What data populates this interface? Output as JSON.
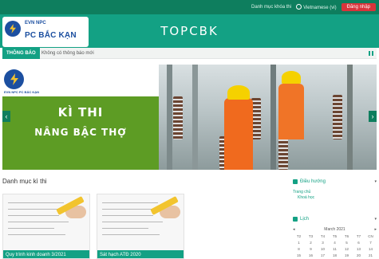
{
  "topbar": {
    "menu_label": "Danh mục khóa thi",
    "lang_label": "Vietnamese (vi)",
    "login_label": "Đăng nhập"
  },
  "header": {
    "logo_top": "EVN NPC",
    "logo_main": "PC BẮC KẠN",
    "site_title": "TOPCBK"
  },
  "notice": {
    "label": "THÔNG BÁO",
    "text": "Không có thông báo mới"
  },
  "banner": {
    "evn_text": "EVN NPC PC BẮC KẠN",
    "headline_1": "KÌ THI",
    "headline_2": "NÂNG BẬC THỢ"
  },
  "courses": {
    "section_title": "Danh mục kì thi",
    "items": [
      {
        "caption": "Quy trình kinh doanh 3/2021"
      },
      {
        "caption": "Sát hạch ATĐ 2020"
      }
    ]
  },
  "sidebar": {
    "nav_title": "Điều hướng",
    "home_label": "Trang chủ",
    "sub_label": "Khoá học",
    "calendar_title": "Lịch",
    "month_label": "March 2021",
    "weekdays": [
      "T2",
      "T3",
      "T4",
      "T5",
      "T6",
      "T7",
      "CN"
    ],
    "days": [
      "1",
      "2",
      "3",
      "4",
      "5",
      "6",
      "7",
      "8",
      "9",
      "10",
      "11",
      "12",
      "13",
      "14",
      "15",
      "16",
      "17",
      "18",
      "19",
      "20",
      "21"
    ]
  },
  "colors": {
    "primary": "#13a184",
    "dark": "#0e7e5e",
    "danger": "#d9343b"
  }
}
